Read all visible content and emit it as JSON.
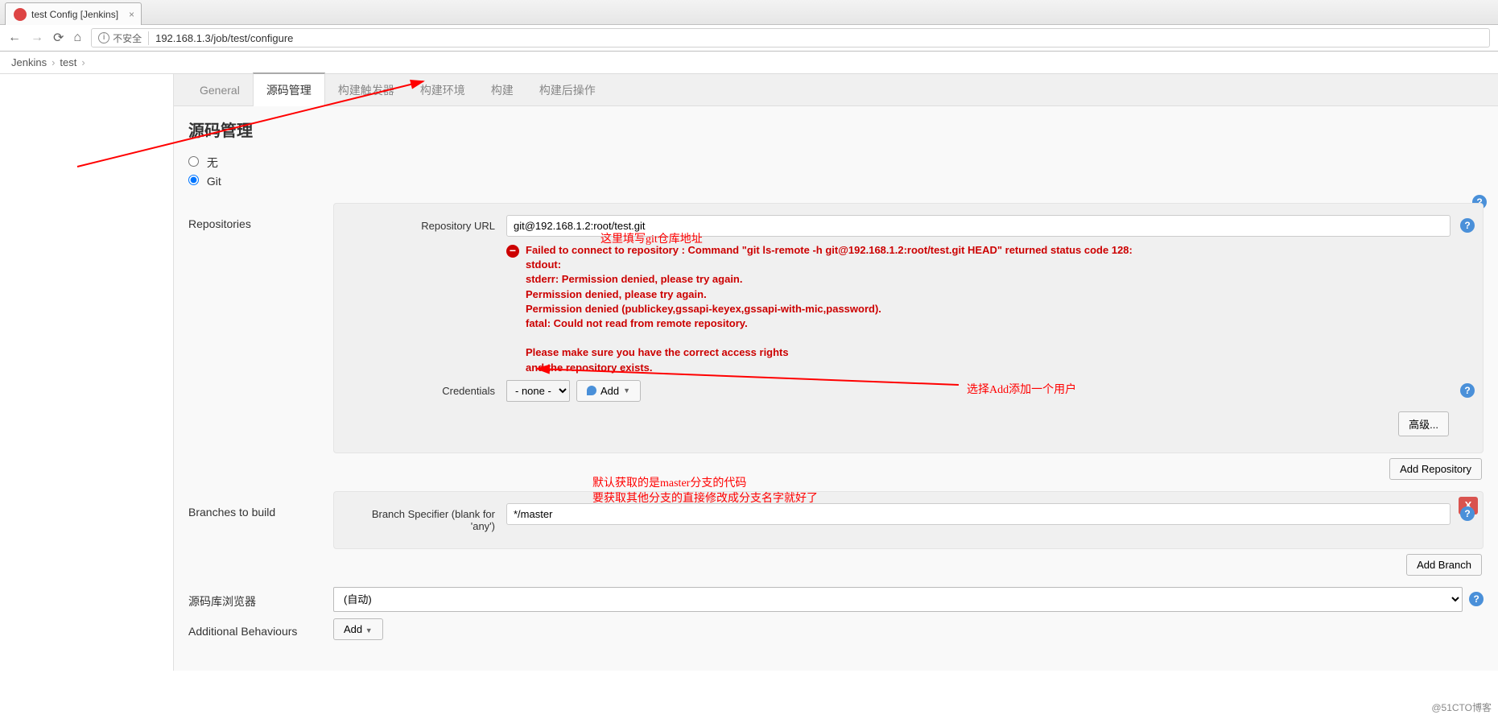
{
  "browser": {
    "tab_title": "test Config [Jenkins]",
    "insecure_label": "不安全",
    "url": "192.168.1.3/job/test/configure"
  },
  "breadcrumbs": {
    "root": "Jenkins",
    "item": "test"
  },
  "tabs": {
    "general": "General",
    "scm": "源码管理",
    "triggers": "构建触发器",
    "env": "构建环境",
    "build": "构建",
    "post": "构建后操作"
  },
  "section": {
    "title": "源码管理",
    "opt_none": "无",
    "opt_git": "Git"
  },
  "repo": {
    "label": "Repositories",
    "url_label": "Repository URL",
    "url_value": "git@192.168.1.2:root/test.git",
    "cred_label": "Credentials",
    "cred_value": "- none -",
    "add_label": "Add",
    "advanced": "高级...",
    "add_repo": "Add Repository",
    "error": "Failed to connect to repository : Command \"git ls-remote -h git@192.168.1.2:root/test.git HEAD\" returned status code 128:\nstdout:\nstderr: Permission denied, please try again.\nPermission denied, please try again.\nPermission denied (publickey,gssapi-keyex,gssapi-with-mic,password).\nfatal: Could not read from remote repository.\n\nPlease make sure you have the correct access rights\nand the repository exists."
  },
  "branches": {
    "label": "Branches to build",
    "spec_label": "Branch Specifier (blank for 'any')",
    "spec_value": "*/master",
    "add_branch": "Add Branch",
    "del": "X"
  },
  "browser_repo": {
    "label": "源码库浏览器",
    "value": "(自动)"
  },
  "additional": {
    "label": "Additional Behaviours",
    "add": "Add"
  },
  "annot": {
    "a1": "这里填写git仓库地址",
    "a2": "选择Add添加一个用户",
    "a3_l1": "默认获取的是master分支的代码",
    "a3_l2": "要获取其他分支的直接修改成分支名字就好了"
  },
  "watermark": "@51CTO博客"
}
